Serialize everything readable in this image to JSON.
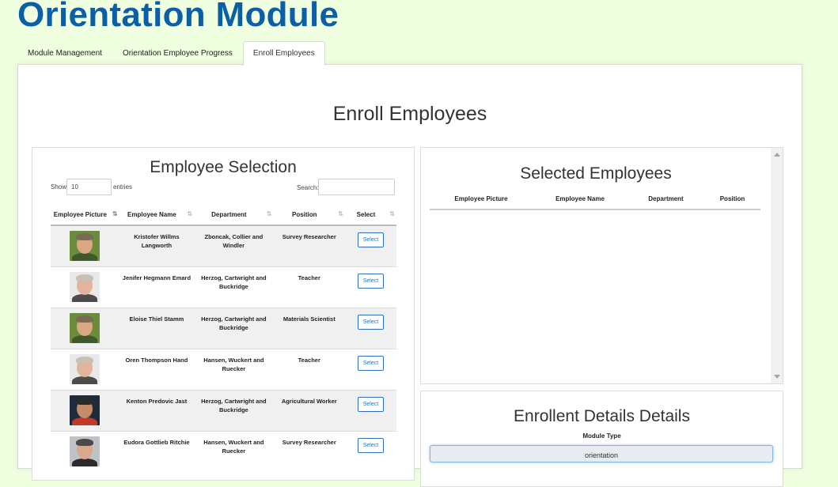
{
  "app": {
    "title": "Orientation Module"
  },
  "tabs": [
    {
      "label": "Module Management"
    },
    {
      "label": "Orientation Employee Progress"
    },
    {
      "label": "Enroll Employees",
      "active": true
    }
  ],
  "page": {
    "title": "Enroll Employees"
  },
  "employee_selection": {
    "title": "Employee Selection",
    "show_label": "Show",
    "page_length": "10",
    "entries_label": "entries",
    "search_label": "Search:",
    "search_value": "",
    "columns": [
      "Employee Picture",
      "Employee Name",
      "Department",
      "Position",
      "Select"
    ],
    "rows": [
      {
        "avatar": "man-green-background",
        "name": "Kristofer Willms Langworth",
        "department": "Zboncak, Collier and Windler",
        "position": "Survey Researcher",
        "action": "Select"
      },
      {
        "avatar": "man-white-background",
        "name": "Jenifer Hegmann Emard",
        "department": "Herzog, Cartwright and Buckridge",
        "position": "Teacher",
        "action": "Select"
      },
      {
        "avatar": "man-green-background",
        "name": "Eloise Thiel Stamm",
        "department": "Herzog, Cartwright and Buckridge",
        "position": "Materials Scientist",
        "action": "Select"
      },
      {
        "avatar": "man-white-background",
        "name": "Oren Thompson Hand",
        "department": "Hansen, Wuckert and Ruecker",
        "position": "Teacher",
        "action": "Select"
      },
      {
        "avatar": "man-dark-background",
        "name": "Kenton Predovic Jast",
        "department": "Herzog, Cartwright and Buckridge",
        "position": "Agricultural Worker",
        "action": "Select"
      },
      {
        "avatar": "man-grey-background",
        "name": "Eudora Gottlieb Ritchie",
        "department": "Hansen, Wuckert and Ruecker",
        "position": "Survey Researcher",
        "action": "Select"
      }
    ]
  },
  "selected_employees": {
    "title": "Selected Employees",
    "columns": [
      "Employee Picture",
      "Employee Name",
      "Department",
      "Position"
    ]
  },
  "enrollment_details": {
    "title": "Enrollent Details Details",
    "module_type_label": "Module Type",
    "module_type_value": "orientation"
  },
  "colors": {
    "background": "#f1ffe1",
    "title": "#0a5fa6",
    "button_accent": "#2c70c4"
  }
}
